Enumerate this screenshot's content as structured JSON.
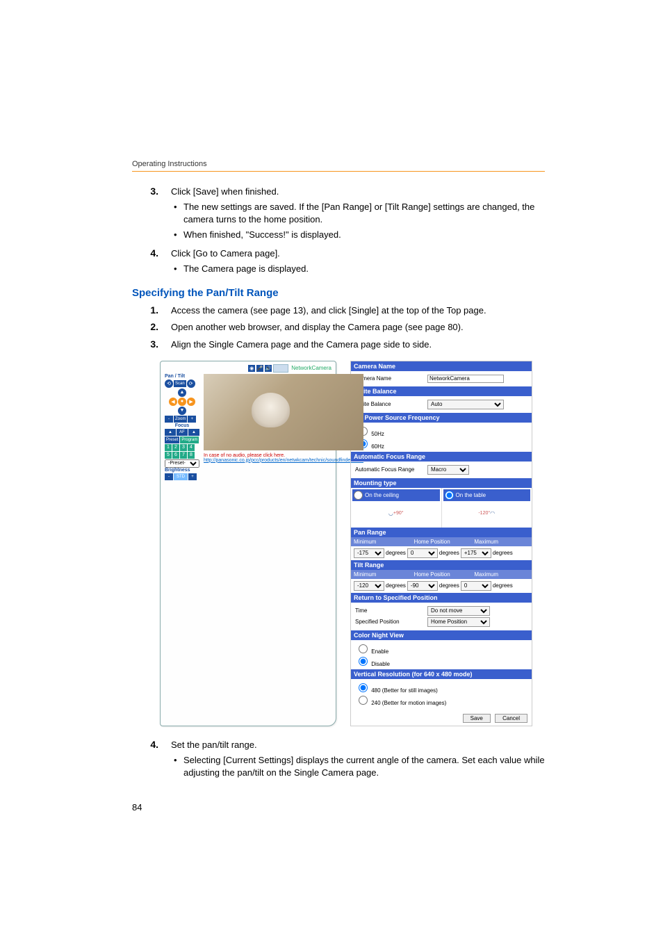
{
  "header": {
    "label": "Operating Instructions"
  },
  "page_number": "84",
  "step3": {
    "num": "3.",
    "text": "Click [Save] when finished.",
    "bullets": [
      "The new settings are saved. If the [Pan Range] or [Tilt Range] settings are changed, the camera turns to the home position.",
      "When finished, \"Success!\" is displayed."
    ]
  },
  "step4": {
    "num": "4.",
    "text": "Click [Go to Camera page].",
    "bullets": [
      "The Camera page is displayed."
    ]
  },
  "section_title": "Specifying the Pan/Tilt Range",
  "sub1": {
    "num": "1.",
    "text": "Access the camera (see page 13), and click [Single] at the top of the Top page."
  },
  "sub2": {
    "num": "2.",
    "text": "Open another web browser, and display the Camera page (see page 80)."
  },
  "sub3": {
    "num": "3.",
    "text": "Align the Single Camera page and the Camera page side to side."
  },
  "sub4": {
    "num": "4.",
    "text": "Set the pan/tilt range.",
    "bullets": [
      "Selecting [Current Settings] displays the current angle of the camera. Set each value while adjusting the pan/tilt on the Single Camera page."
    ]
  },
  "left_panel": {
    "nc_label": "NetworkCamera",
    "pantilt": "Pan / Tilt",
    "scan": "Scan",
    "zoom": "Zoom",
    "focus": "Focus",
    "preset": "Preset",
    "program": "Program",
    "preset_select": "-Preset-",
    "brightness": "Brightness",
    "link_red": "In case of no audio, please click here.",
    "link_blue": "http://panasonic.co.jp/pcc/products/en/netwkcam/technic/soundfindex.html"
  },
  "right_panel": {
    "camera_name_h": "Camera Name",
    "camera_name_l": "Camera Name",
    "camera_name_v": "NetworkCamera",
    "white_balance_h": "White Balance",
    "white_balance_l": "White Balance",
    "white_balance_v": "Auto",
    "ac_h": "AC Power Source Frequency",
    "ac_50": "50Hz",
    "ac_60": "60Hz",
    "afr_h": "Automatic Focus Range",
    "afr_l": "Automatic Focus Range",
    "afr_v": "Macro",
    "mount_h": "Mounting type",
    "mount_ceiling": "On the ceiling",
    "mount_table": "On the table",
    "mount_ceiling_deg": "+90°",
    "mount_table_deg": "-120°",
    "pan_h": "Pan Range",
    "col_min": "Minimum",
    "col_home": "Home Position",
    "col_max": "Maximum",
    "pan_min": "-175",
    "pan_home": "0",
    "pan_max": "+175",
    "tilt_h": "Tilt Range",
    "tilt_min": "-120",
    "tilt_home": "-90",
    "tilt_max": "0",
    "deg": "degrees",
    "rsp_h": "Return to Specified Position",
    "rsp_time_l": "Time",
    "rsp_time_v": "Do not move",
    "rsp_pos_l": "Specified Position",
    "rsp_pos_v": "Home Position",
    "cnv_h": "Color Night View",
    "cnv_enable": "Enable",
    "cnv_disable": "Disable",
    "vres_h": "Vertical Resolution (for 640 x 480 mode)",
    "vres_480": "480 (Better for still images)",
    "vres_240": "240 (Better for motion images)",
    "save": "Save",
    "cancel": "Cancel"
  }
}
